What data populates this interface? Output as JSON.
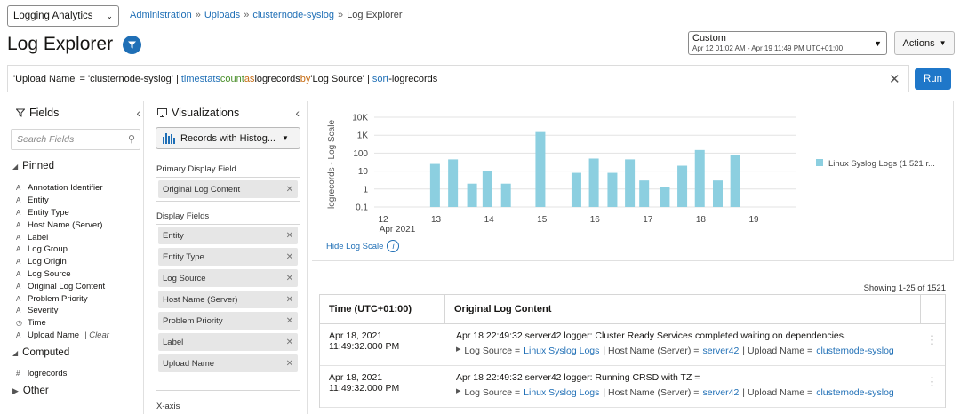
{
  "header": {
    "app_select": "Logging Analytics",
    "breadcrumb": [
      "Administration",
      "Uploads",
      "clusternode-syslog"
    ],
    "breadcrumb_current": "Log Explorer",
    "page_title": "Log Explorer",
    "time_range_label": "Custom",
    "time_range_value": "Apr 12 01:02 AM - Apr 19 11:49 PM UTC+01:00",
    "actions_label": "Actions"
  },
  "query": {
    "part1": "'Upload Name' = 'clusternode-syslog' | ",
    "kw1": "timestats",
    "fn1": "count",
    "op1": "as",
    "part2": "logrecords",
    "op2": "by",
    "part3": "'Log Source' | ",
    "kw2": "sort",
    "part4": "-logrecords",
    "run_label": "Run"
  },
  "fields_panel": {
    "title": "Fields",
    "search_placeholder": "Search Fields",
    "pinned_label": "Pinned",
    "pinned": [
      {
        "type": "A",
        "label": "Annotation Identifier"
      },
      {
        "type": "A",
        "label": "Entity"
      },
      {
        "type": "A",
        "label": "Entity Type"
      },
      {
        "type": "A",
        "label": "Host Name (Server)"
      },
      {
        "type": "A",
        "label": "Label"
      },
      {
        "type": "A",
        "label": "Log Group"
      },
      {
        "type": "A",
        "label": "Log Origin"
      },
      {
        "type": "A",
        "label": "Log Source"
      },
      {
        "type": "A",
        "label": "Original Log Content"
      },
      {
        "type": "A",
        "label": "Problem Priority"
      },
      {
        "type": "A",
        "label": "Severity"
      },
      {
        "type": "◷",
        "label": "Time"
      },
      {
        "type": "A",
        "label": "Upload Name"
      }
    ],
    "clear_label": "Clear",
    "computed_label": "Computed",
    "computed": [
      {
        "type": "#",
        "label": "logrecords"
      }
    ],
    "other_label": "Other"
  },
  "viz_panel": {
    "title": "Visualizations",
    "selected": "Records with Histog...",
    "primary_label": "Primary Display Field",
    "primary_chip": "Original Log Content",
    "display_label": "Display Fields",
    "display_chips": [
      "Entity",
      "Entity Type",
      "Log Source",
      "Host Name (Server)",
      "Problem Priority",
      "Label",
      "Upload Name"
    ],
    "xaxis_label": "X-axis"
  },
  "chart_data": {
    "type": "bar",
    "y_scale": "log",
    "ylabel": "logrecords - Log Scale",
    "y_ticks": [
      "10K",
      "1K",
      "100",
      "10",
      "1",
      "0.1"
    ],
    "x_ticks": [
      "12",
      "13",
      "14",
      "15",
      "16",
      "17",
      "18",
      "19"
    ],
    "x_sublabel": "Apr 2021",
    "legend_position": "right",
    "series": [
      {
        "name": "Linux Syslog Logs (1,521 r...",
        "color": "#8ccfe0",
        "x": [
          12.98,
          13.32,
          13.68,
          13.97,
          14.32,
          14.97,
          15.65,
          15.98,
          16.33,
          16.66,
          16.93,
          17.32,
          17.65,
          17.98,
          18.32,
          18.65
        ],
        "values": [
          25,
          45,
          2,
          10,
          2,
          1500,
          8,
          50,
          8,
          45,
          3,
          1.3,
          20,
          150,
          3,
          80
        ]
      }
    ]
  },
  "chart_controls": {
    "hide_scale": "Hide Log Scale"
  },
  "table": {
    "showing": "Showing 1-25 of 1521",
    "columns": [
      "Time (UTC+01:00)",
      "Original Log Content"
    ],
    "rows": [
      {
        "date": "Apr 18, 2021",
        "time": "11:49:32.000 PM",
        "message": "Apr 18 22:49:32 server42 logger: Cluster Ready Services completed waiting on dependencies.",
        "log_source_label": "Log Source =",
        "log_source": "Linux Syslog Logs",
        "host_label": "| Host Name (Server) =",
        "host": "server42",
        "upload_label": "| Upload Name =",
        "upload": "clusternode-syslog"
      },
      {
        "date": "Apr 18, 2021",
        "time": "11:49:32.000 PM",
        "message": "Apr 18 22:49:32 server42 logger: Running CRSD with TZ =",
        "log_source_label": "Log Source =",
        "log_source": "Linux Syslog Logs",
        "host_label": "| Host Name (Server) =",
        "host": "server42",
        "upload_label": "| Upload Name =",
        "upload": "clusternode-syslog"
      }
    ]
  }
}
